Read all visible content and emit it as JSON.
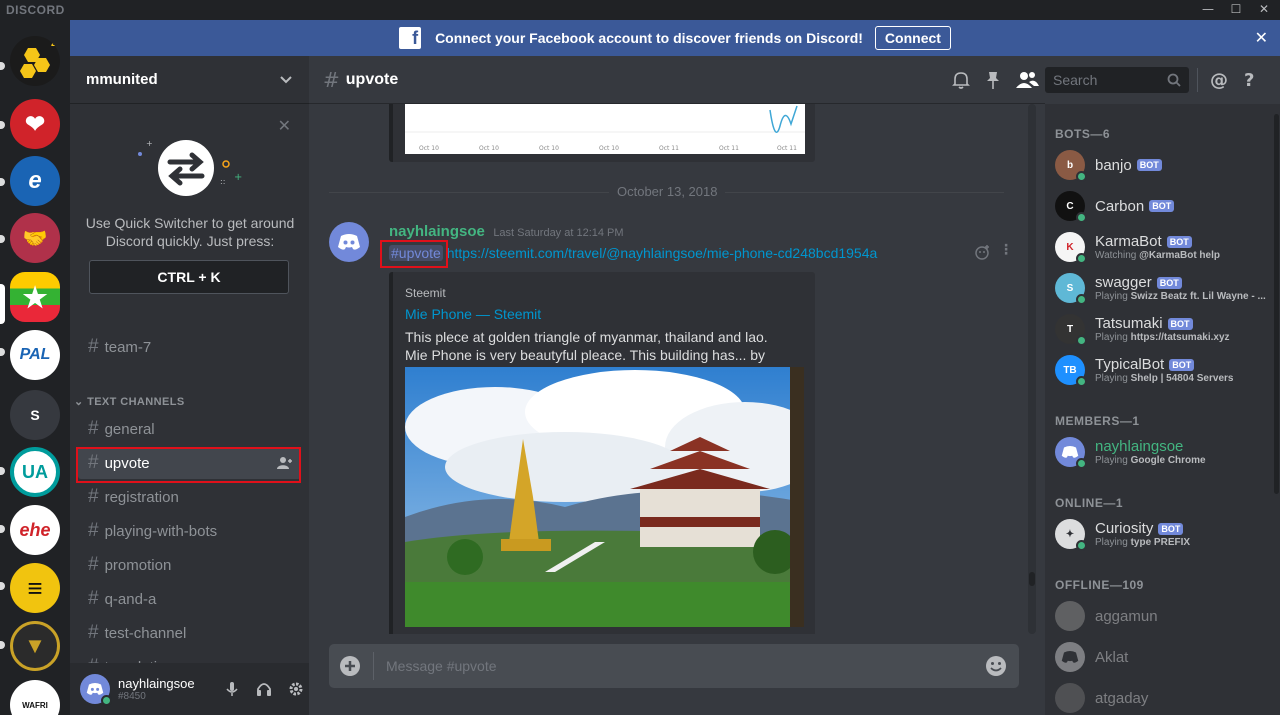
{
  "app": {
    "logo": "DISCORD",
    "min": "—",
    "max": "☐",
    "close": "✕"
  },
  "facebook_bar": {
    "icon": "f",
    "message": "Connect your Facebook account to discover friends on Discord!",
    "button": "Connect",
    "close": "✕"
  },
  "guilds": [
    {
      "name": "honeycomb-server",
      "label": "",
      "color": "#1b1b1b",
      "badge": "2"
    },
    {
      "name": "heart-server",
      "label": "❤",
      "color": "#d0232a"
    },
    {
      "name": "e-server",
      "label": "e",
      "color": "#1a64b4"
    },
    {
      "name": "handshake-server",
      "label": "🤝",
      "color": "#b0314a"
    },
    {
      "name": "myanmar-flag-server",
      "label": "★",
      "color": "#34b233"
    },
    {
      "name": "pal-server",
      "label": "PAL",
      "color": "#ffffff"
    },
    {
      "name": "s-server",
      "label": "S",
      "color": "#36393f"
    },
    {
      "name": "un-server",
      "label": "UA",
      "color": "#ffffff"
    },
    {
      "name": "ehe-server",
      "label": "ehe",
      "color": "#ffffff"
    },
    {
      "name": "menu-server",
      "label": "≡",
      "color": "#f1c40f"
    },
    {
      "name": "shield-server",
      "label": "▼",
      "color": "#c9a227"
    },
    {
      "name": "wafri-server",
      "label": "WAFRI",
      "color": "#ffffff"
    }
  ],
  "server": {
    "name": "mmunited"
  },
  "quick_switcher": {
    "close": "✕",
    "line1": "Use Quick Switcher to get around",
    "line2": "Discord quickly. Just press:",
    "shortcut": "CTRL + K"
  },
  "channels": {
    "top": {
      "name": "team-7"
    },
    "category": "TEXT CHANNELS",
    "list": [
      "general",
      "upvote",
      "registration",
      "playing-with-bots",
      "promotion",
      "q-and-a",
      "test-channel",
      "translation"
    ],
    "selected": "upvote"
  },
  "user": {
    "name": "nayhlaingsoe",
    "tag": "#8450"
  },
  "chat": {
    "channel": "upvote",
    "date_divider": "October 13, 2018",
    "chart_ticks": [
      "Oct 10",
      "Oct 10",
      "Oct 10",
      "Oct 10",
      "Oct 11",
      "Oct 11",
      "Oct 11"
    ],
    "message": {
      "author": "nayhlaingsoe",
      "timestamp": "Last Saturday at 12:14 PM",
      "mention": "#upvote",
      "link": "https://steemit.com/travel/@nayhlaingsoe/mie-phone-cd248bcd1954a"
    },
    "embed": {
      "provider": "Steemit",
      "title": "Mie Phone — Steemit",
      "description": "This plece at golden triangle of myanmar, thailand and lao. Mie Phone is very beautyful pleace. This building has... by nayhlaingsoe"
    },
    "input_placeholder": "Message #upvote"
  },
  "header": {
    "search_placeholder": "Search"
  },
  "members": {
    "bots_header": "BOTS—6",
    "bots": [
      {
        "name": "banjo",
        "badge": "BOT",
        "status": "",
        "avatar": "#8a5a44",
        "initial": "b"
      },
      {
        "name": "Carbon",
        "badge": "BOT",
        "status": "",
        "avatar": "#111111",
        "initial": "C"
      },
      {
        "name": "KarmaBot",
        "badge": "BOT",
        "status_prefix": "Watching",
        "status": "@KarmaBot help",
        "avatar": "#f5f5f5",
        "initial": "K"
      },
      {
        "name": "swagger",
        "badge": "BOT",
        "status_prefix": "Playing",
        "status": "Swizz Beatz ft. Lil Wayne - ...",
        "avatar": "#5fb8d6",
        "initial": "S"
      },
      {
        "name": "Tatsumaki",
        "badge": "BOT",
        "status_prefix": "Playing",
        "status": "https://tatsumaki.xyz",
        "avatar": "#333333",
        "initial": "T"
      },
      {
        "name": "TypicalBot",
        "badge": "BOT",
        "status_prefix": "Playing",
        "status": "Shelp | 54804 Servers",
        "avatar": "#1e90ff",
        "initial": "TB"
      }
    ],
    "members_header": "MEMBERS—1",
    "member": {
      "name": "nayhlaingsoe",
      "status_prefix": "Playing",
      "status": "Google Chrome"
    },
    "online_header": "ONLINE—1",
    "online": {
      "name": "Curiosity",
      "badge": "BOT",
      "status_prefix": "Playing",
      "status": "type PREFIX"
    },
    "offline_header": "OFFLINE—109",
    "offline": [
      "aggamun",
      "Aklat",
      "atgaday"
    ]
  }
}
